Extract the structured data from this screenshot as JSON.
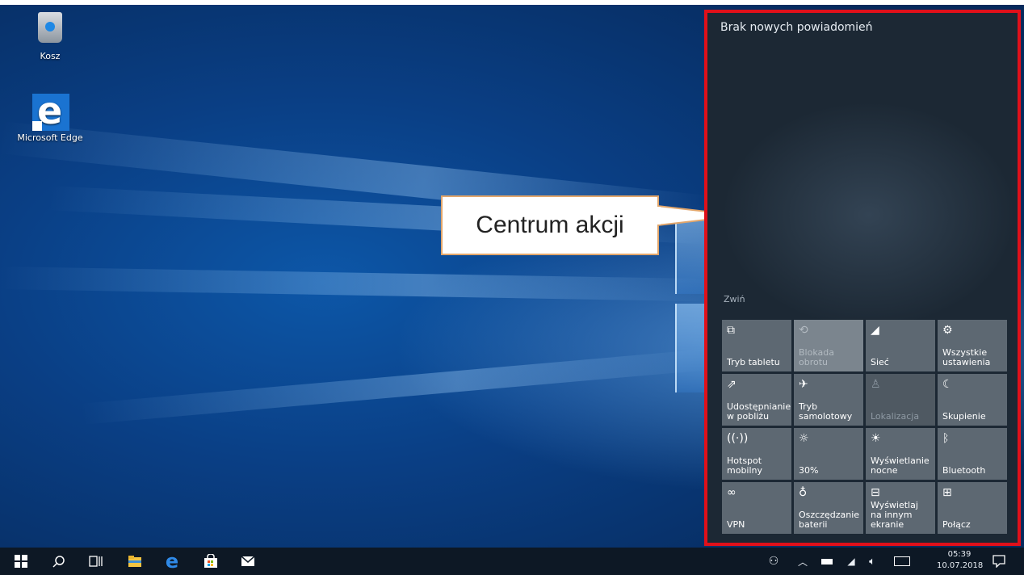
{
  "desktop": {
    "icons": [
      {
        "label": "Kosz",
        "icon": "recycle-bin-icon"
      },
      {
        "label": "Microsoft Edge",
        "icon": "edge-icon"
      }
    ]
  },
  "callout": {
    "label": "Centrum akcji"
  },
  "action_center": {
    "notifications_title": "Brak nowych powiadomień",
    "collapse_label": "Zwiń",
    "tiles": [
      {
        "label": "Tryb tabletu",
        "icon": "tablet-mode-icon",
        "glyph": "⧉",
        "state": "on"
      },
      {
        "label": "Blokada obrotu",
        "icon": "rotation-lock-icon",
        "glyph": "⟲",
        "state": "disabled"
      },
      {
        "label": "Sieć",
        "icon": "network-icon",
        "glyph": "◢",
        "state": "on"
      },
      {
        "label": "Wszystkie ustawienia",
        "icon": "settings-gear-icon",
        "glyph": "⚙",
        "state": "on"
      },
      {
        "label": "Udostępnianie w pobliżu",
        "icon": "nearby-sharing-icon",
        "glyph": "⇗",
        "state": "on"
      },
      {
        "label": "Tryb samolotowy",
        "icon": "airplane-icon",
        "glyph": "✈",
        "state": "on"
      },
      {
        "label": "Lokalizacja",
        "icon": "location-icon",
        "glyph": "♙",
        "state": "off"
      },
      {
        "label": "Skupienie",
        "icon": "focus-moon-icon",
        "glyph": "☾",
        "state": "on"
      },
      {
        "label": "Hotspot mobilny",
        "icon": "hotspot-icon",
        "glyph": "((·))",
        "state": "on"
      },
      {
        "label": "30%",
        "icon": "brightness-icon",
        "glyph": "☼",
        "state": "on"
      },
      {
        "label": "Wyświetlanie nocne",
        "icon": "night-light-icon",
        "glyph": "☀",
        "state": "on"
      },
      {
        "label": "Bluetooth",
        "icon": "bluetooth-icon",
        "glyph": "ᛒ",
        "state": "on"
      },
      {
        "label": "VPN",
        "icon": "vpn-icon",
        "glyph": "∞",
        "state": "on"
      },
      {
        "label": "Oszczędzanie baterii",
        "icon": "battery-saver-icon",
        "glyph": "♁",
        "state": "on"
      },
      {
        "label": "Wyświetlaj na innym ekranie",
        "icon": "project-icon",
        "glyph": "⊟",
        "state": "on"
      },
      {
        "label": "Połącz",
        "icon": "connect-icon",
        "glyph": "⊞",
        "state": "on"
      }
    ]
  },
  "taskbar": {
    "clock_time": "05:39",
    "clock_date": "10.07.2018"
  },
  "colors": {
    "highlight_border": "#e0101a",
    "callout_border": "#e2a66b",
    "tile_bg": "#5d6872",
    "panel_bg": "#1c2834",
    "taskbar_bg": "#0d1825"
  }
}
